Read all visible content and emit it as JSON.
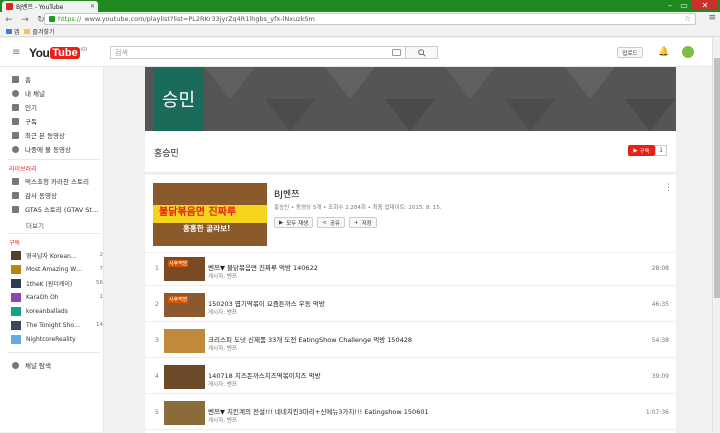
{
  "browser": {
    "tab_title": "BJ벤쯔 - YouTube",
    "url_scheme": "https://",
    "url_rest": "www.youtube.com/playlist?list=PL2RKr33jyrZq4R1lhgbs_yfx-lNxuzkSm",
    "bookmarks": [
      "앱",
      "즐겨찾기"
    ]
  },
  "masthead": {
    "logo_you": "You",
    "logo_tube": "Tube",
    "logo_region": "KR",
    "search_placeholder": "검색",
    "upload_label": "업로드"
  },
  "sidebar": {
    "nav": [
      {
        "label": "홈",
        "icon": "home-icon"
      },
      {
        "label": "내 채널",
        "icon": "person-icon"
      },
      {
        "label": "인기",
        "icon": "fire-icon"
      },
      {
        "label": "구독",
        "icon": "subscriptions-icon"
      },
      {
        "label": "최근 본 동영상",
        "icon": "history-icon"
      },
      {
        "label": "나중에 볼 동영상",
        "icon": "clock-icon"
      }
    ],
    "library_heading": "라이브러리",
    "library": [
      {
        "label": "먹스초청 카라찬 스토리",
        "icon": "playlist-icon"
      },
      {
        "label": "감사 동영상",
        "icon": "playlist-icon"
      },
      {
        "label": "GTA5 스토리 (GTAV St…",
        "icon": "playlist-icon"
      }
    ],
    "more_label": "더보기",
    "subs_heading": "구독",
    "subscriptions": [
      {
        "name": "영국남자 Korean…",
        "count": "2",
        "color": "#5a3d2b"
      },
      {
        "name": "Most Amazing W…",
        "count": "7",
        "color": "#b8860b"
      },
      {
        "name": "1theK (원더케이)",
        "count": "56",
        "color": "#2c3e50"
      },
      {
        "name": "KaraOh Oh",
        "count": "1",
        "color": "#8e44ad"
      },
      {
        "name": "koreanballads",
        "count": "",
        "color": "#16a085"
      },
      {
        "name": "The Tonight Sho…",
        "count": "14",
        "color": "#34495e"
      },
      {
        "name": "NightcoreReality",
        "count": "",
        "color": "#5dade2"
      }
    ],
    "browse_label": "채널 탐색"
  },
  "channel": {
    "banner_text": "승민",
    "name": "홍승민",
    "subscribe_label": "구독",
    "subscriber_count": "1"
  },
  "playlist": {
    "title": "BJ벤쯔",
    "meta": "홍승민 • 동영상 5개 • 조회수 2,284회 • 최종 업데이트: 2015. 8. 15.",
    "thumb_text1": "불닭볶음면 진짜루",
    "thumb_text2": "홍홍한 골라보!",
    "play_all_label": "모두 재생",
    "share_label": "공유",
    "save_label": "저장",
    "items": [
      {
        "index": "1",
        "title": "벤쯔▼ 불닭볶음면 진짜루 먹방 140622",
        "owner": "게시자: 벤쯔",
        "duration": "28:08",
        "thumb_label": "사후먹방",
        "thumb_color": "#7a4a24"
      },
      {
        "index": "2",
        "title": "150203 엽기떡볶이 요즘튼까스 우동 먹방",
        "owner": "게시자: 벤쯔",
        "duration": "46:35",
        "thumb_label": "사후먹방",
        "thumb_color": "#8a5a2e"
      },
      {
        "index": "3",
        "title": "크리스피 도넛 신제품 33개 도전 EatingShow Challenge 먹방 150428",
        "owner": "게시자: 벤쯔",
        "duration": "54:38",
        "thumb_label": "",
        "thumb_color": "#c08a3c"
      },
      {
        "index": "4",
        "title": "140718 치즈돈까스치즈떡볶이치즈 먹방",
        "owner": "게시자: 벤쯔",
        "duration": "39:09",
        "thumb_label": "",
        "thumb_color": "#6b4a2a"
      },
      {
        "index": "5",
        "title": "벤쯔▼ 치킨계의 전설!!! 네네치킨3마리+신메뉴3가지!!! Eatingshow 150601",
        "owner": "게시자: 벤쯔",
        "duration": "1:07:36",
        "thumb_label": "",
        "thumb_color": "#8b6b3a"
      }
    ]
  },
  "colors": {
    "brand_red": "#e62117",
    "chrome_green": "#1f8a1f",
    "banner_teal": "#1b6b5a"
  }
}
